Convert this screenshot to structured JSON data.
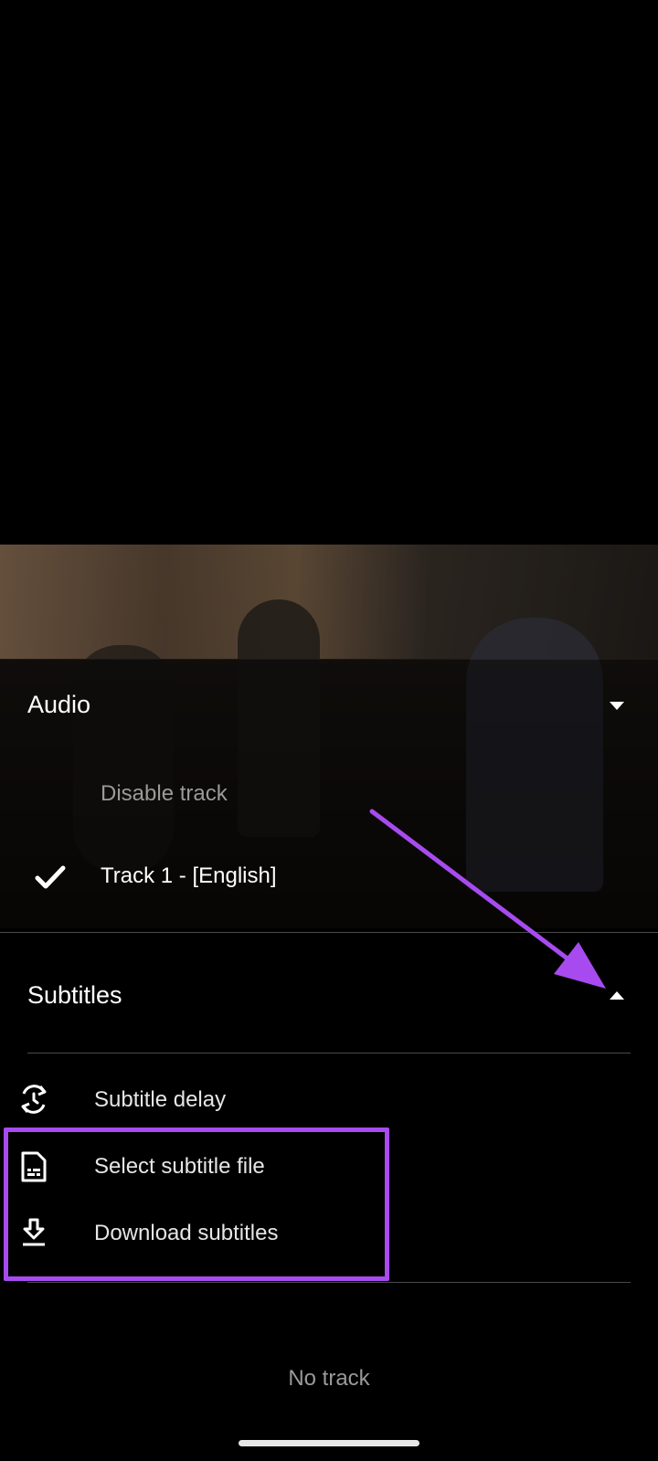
{
  "audio": {
    "header": "Audio",
    "items": [
      {
        "label": "Disable track",
        "selected": false
      },
      {
        "label": "Track 1 - [English]",
        "selected": true
      }
    ]
  },
  "subtitles": {
    "header": "Subtitles",
    "options": [
      {
        "label": "Subtitle delay",
        "icon": "subtitle-delay-icon"
      },
      {
        "label": "Select subtitle file",
        "icon": "subtitle-file-icon"
      },
      {
        "label": "Download subtitles",
        "icon": "download-icon"
      }
    ],
    "no_track_label": "No track"
  },
  "colors": {
    "annotation": "#a74bf0",
    "muted_text": "#9a9a9a"
  }
}
